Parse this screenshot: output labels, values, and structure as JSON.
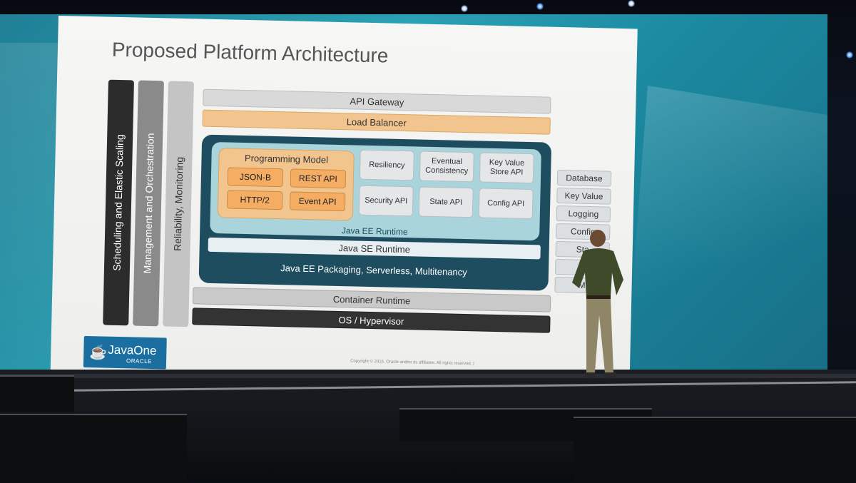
{
  "slide": {
    "title": "Proposed Platform Architecture",
    "vertical_bars": [
      {
        "label": "Scheduling and Elastic Scaling",
        "color": "#2c2c2c",
        "text_color": "#ffffff"
      },
      {
        "label": "Management and Orchestration",
        "color": "#8a8a8a",
        "text_color": "#ffffff"
      },
      {
        "label": "Reliability, Monitoring",
        "color": "#c4c4c4",
        "text_color": "#333333"
      }
    ],
    "api_gateway": "API Gateway",
    "load_balancer": "Load Balancer",
    "programming_model": {
      "title": "Programming Model",
      "items": [
        "JSON-B",
        "REST API",
        "HTTP/2",
        "Event API"
      ]
    },
    "runtime_apis": [
      "Resiliency",
      "Eventual Consistency",
      "Key Value Store API",
      "Security API",
      "State API",
      "Config API"
    ],
    "java_ee_runtime": "Java EE Runtime",
    "java_se_runtime": "Java SE Runtime",
    "packaging": "Java EE Packaging, Serverless, Multitenancy",
    "container_runtime": "Container Runtime",
    "os_hypervisor": "OS / Hypervisor",
    "side_services": [
      "Database",
      "Key Value",
      "Logging",
      "Config",
      "Sta",
      "S",
      "M"
    ],
    "logo": {
      "name": "JavaOne",
      "sub": "ORACLE"
    },
    "copyright": "Copyright © 2016, Oracle and/or its affiliates. All rights reserved.  |"
  },
  "colors": {
    "screen_teal": "#2ba1b5",
    "load_balancer": "#f2c58f",
    "programming_model": "#f4ad62",
    "ee_dark": "#1f4d60",
    "ee_light": "#a9d4dc"
  }
}
